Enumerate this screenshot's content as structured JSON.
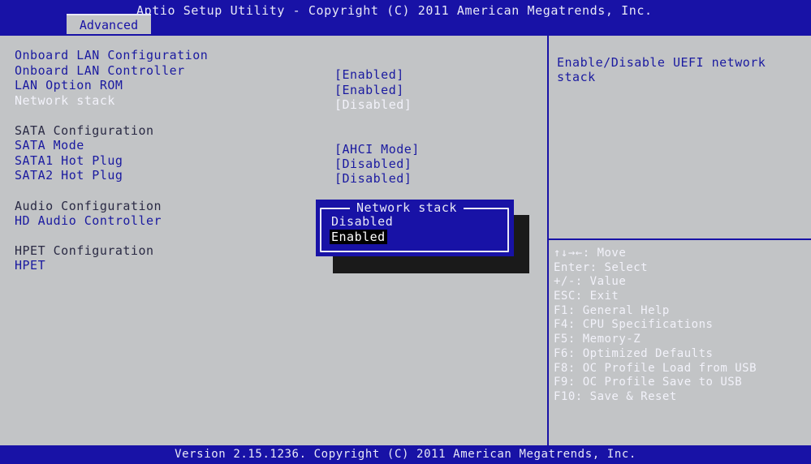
{
  "header": {
    "title": "Aptio Setup Utility - Copyright (C) 2011 American Megatrends, Inc.",
    "active_tab": "Advanced"
  },
  "settings": [
    {
      "label": "Onboard LAN Configuration",
      "value": ""
    },
    {
      "label": "Onboard LAN Controller",
      "value": "[Enabled]"
    },
    {
      "label": "LAN Option ROM",
      "value": "[Enabled]"
    },
    {
      "label": "Network stack",
      "value": "[Disabled]"
    },
    {
      "label": "SATA Configuration",
      "value": ""
    },
    {
      "label": "SATA Mode",
      "value": "[AHCI Mode]"
    },
    {
      "label": "SATA1 Hot Plug",
      "value": "[Disabled]"
    },
    {
      "label": "SATA2 Hot Plug",
      "value": "[Disabled]"
    },
    {
      "label": "Audio Configuration",
      "value": ""
    },
    {
      "label": "HD Audio Controller",
      "value": ""
    },
    {
      "label": "HPET Configuration",
      "value": ""
    },
    {
      "label": "HPET",
      "value": ""
    }
  ],
  "help": {
    "description": "Enable/Disable UEFI network stack",
    "keys": [
      "↑↓→←: Move",
      "Enter: Select",
      "+/-: Value",
      "ESC: Exit",
      "F1: General Help",
      "F4: CPU Specifications",
      "F5: Memory-Z",
      "F6: Optimized Defaults",
      "F8: OC Profile Load from USB",
      "F9: OC Profile Save to USB",
      "F10: Save & Reset"
    ]
  },
  "popup": {
    "title": "Network stack",
    "options": [
      "Disabled",
      "Enabled"
    ],
    "selected": "Enabled"
  },
  "footer": {
    "text": "Version 2.15.1236. Copyright (C) 2011 American Megatrends, Inc."
  },
  "colors": {
    "background": "#c2c4c6",
    "bar_blue": "#1812a6",
    "text_blue": "#1a1aa0",
    "highlight_white": "#f2f2fa"
  }
}
